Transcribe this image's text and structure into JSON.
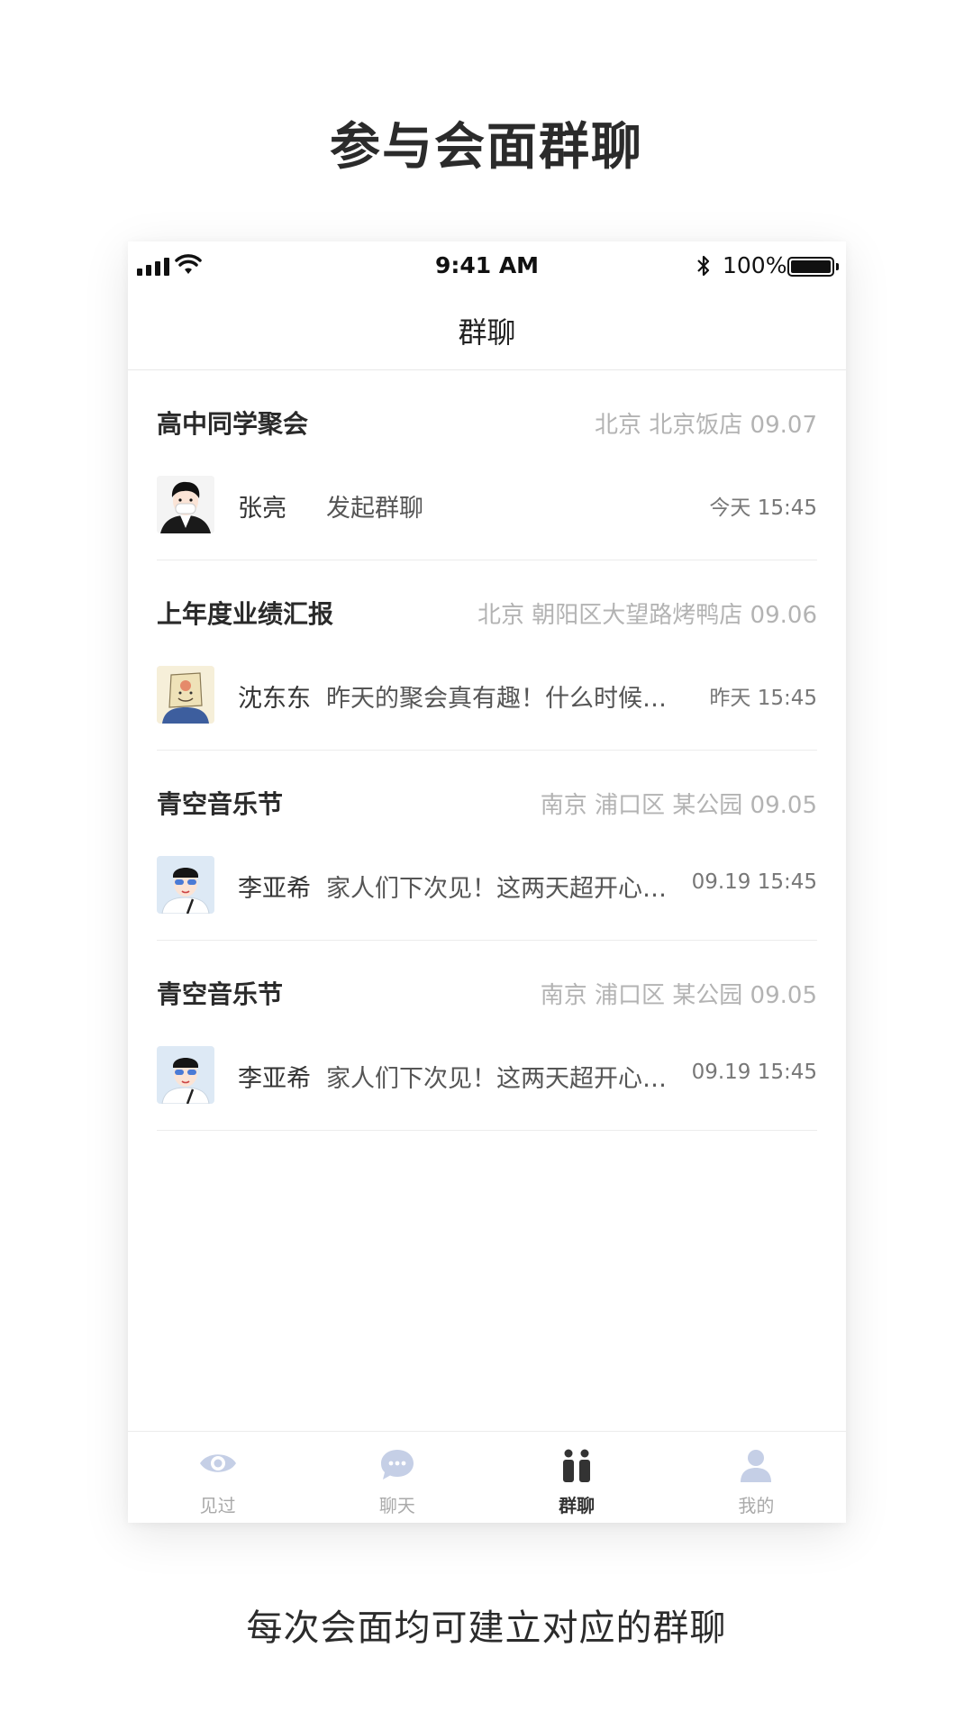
{
  "page": {
    "title": "参与会面群聊",
    "caption": "每次会面均可建立对应的群聊"
  },
  "status_bar": {
    "time": "9:41 AM",
    "battery": "100%"
  },
  "nav": {
    "title": "群聊"
  },
  "groups": [
    {
      "name": "高中同学聚会",
      "meta": "北京 北京饭店 09.07",
      "sender": "张亮",
      "message": "发起群聊",
      "time": "今天 15:45",
      "avatar": "avatar-man-mask"
    },
    {
      "name": "上年度业绩汇报",
      "meta": "北京 朝阳区大望路烤鸭店 09.06",
      "sender": "沈东东",
      "message": "昨天的聚会真有趣！什么时候…",
      "time": "昨天 15:45",
      "avatar": "avatar-bag-head"
    },
    {
      "name": "青空音乐节",
      "meta": "南京 浦口区 某公园 09.05",
      "sender": "李亚希",
      "message": "家人们下次见！这两天超开心…",
      "time": "09.19 15:45",
      "avatar": "avatar-cap-boy"
    },
    {
      "name": "青空音乐节",
      "meta": "南京 浦口区 某公园 09.05",
      "sender": "李亚希",
      "message": "家人们下次见！这两天超开心…",
      "time": "09.19 15:45",
      "avatar": "avatar-cap-boy"
    }
  ],
  "tabs": [
    {
      "label": "见过",
      "icon": "eye-icon",
      "active": false
    },
    {
      "label": "聊天",
      "icon": "chat-bubble-icon",
      "active": false
    },
    {
      "label": "群聊",
      "icon": "group-icon",
      "active": true
    },
    {
      "label": "我的",
      "icon": "person-icon",
      "active": false
    }
  ],
  "colors": {
    "active_tab": "#333333",
    "inactive_tab": "#c5cfe6",
    "meta_text": "#b3b3b3"
  }
}
